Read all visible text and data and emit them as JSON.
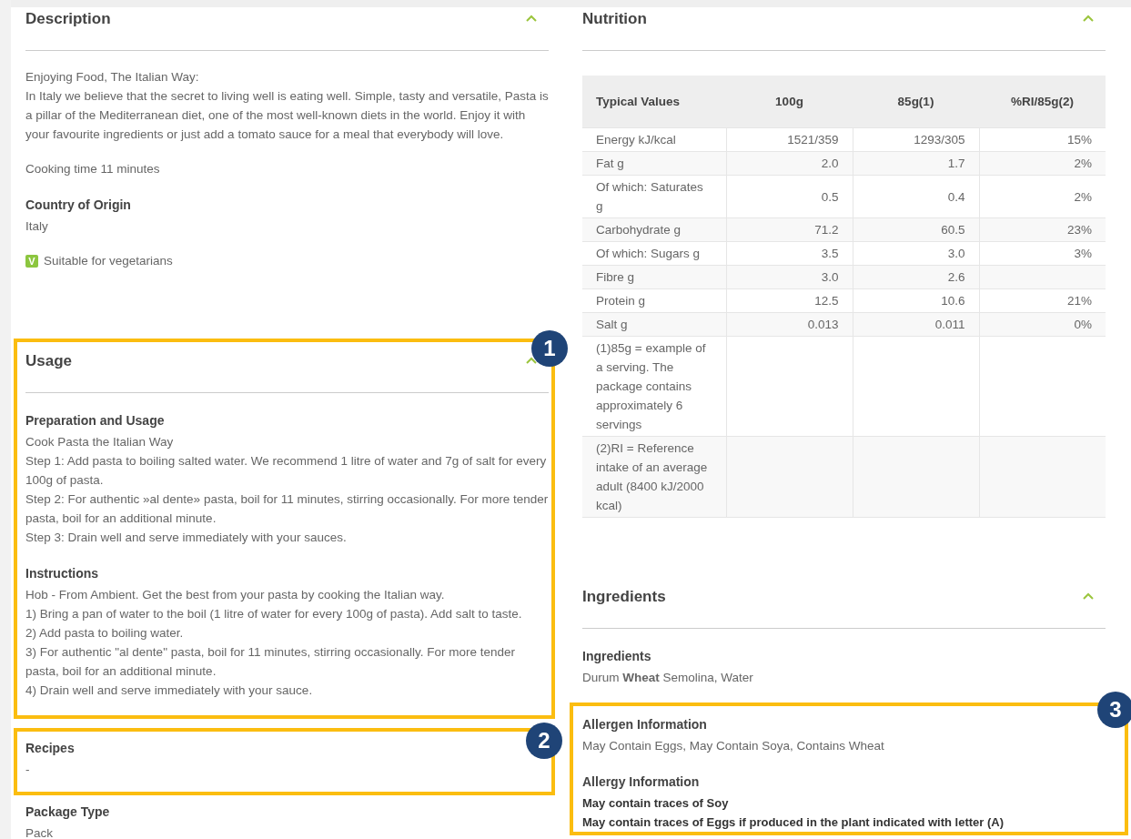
{
  "columns": [
    {
      "items": [
        {
          "kind": "panel",
          "title": "Description",
          "expanded": true,
          "blocks": [
            {
              "kind": "paragraph",
              "lines": [
                "Enjoying Food, The Italian Way:",
                "In Italy we believe that the secret to living well is eating well. Simple, tasty and versatile, Pasta is a pillar of the Mediterranean diet, one of the most well-known diets in the world. Enjoy it with your favourite ingredients or just add a tomato sauce for a meal that everybody will love."
              ]
            },
            {
              "kind": "paragraph",
              "lines": [
                "Cooking time 11 minutes"
              ]
            },
            {
              "kind": "field",
              "label": "Country of Origin",
              "lines": [
                {
                  "text": "Italy",
                  "emphasis": false
                }
              ]
            },
            {
              "kind": "badge",
              "mark": "V",
              "label": "Suitable for vegetarians"
            }
          ]
        },
        {
          "kind": "panel",
          "title": "Usage",
          "expanded": true,
          "callout": "1",
          "blocks": [
            {
              "kind": "field",
              "label": "Preparation and Usage",
              "lines": [
                {
                  "text": "Cook Pasta the Italian Way",
                  "emphasis": false
                },
                {
                  "text": "Step 1: Add pasta to boiling salted water. We recommend 1 litre of water and 7g of salt for every 100g of pasta.",
                  "emphasis": false
                },
                {
                  "text": "Step 2: For authentic »al dente» pasta, boil for 11 minutes, stirring occasionally. For more tender pasta, boil for an additional minute.",
                  "emphasis": false
                },
                {
                  "text": "Step 3: Drain well and serve immediately with your sauces.",
                  "emphasis": false
                }
              ]
            },
            {
              "kind": "field",
              "label": "Instructions",
              "lines": [
                {
                  "text": "Hob - From Ambient. Get the best from your pasta by cooking the Italian way.",
                  "emphasis": false
                },
                {
                  "text": "1) Bring a pan of water to the boil (1 litre of water for every 100g of pasta). Add salt to taste.",
                  "emphasis": false
                },
                {
                  "text": "2) Add pasta to boiling water.",
                  "emphasis": false
                },
                {
                  "text": "3) For authentic \"al dente\" pasta, boil for 11 minutes, stirring occasionally. For more tender pasta, boil for an additional minute.",
                  "emphasis": false
                },
                {
                  "text": "4) Drain well and serve immediately with your sauce.",
                  "emphasis": false
                }
              ]
            }
          ]
        },
        {
          "kind": "field",
          "label": "Recipes",
          "callout": "2",
          "lines": [
            {
              "text": "-",
              "emphasis": false
            }
          ]
        },
        {
          "kind": "field",
          "label": "Package Type",
          "lines": [
            {
              "text": "Pack",
              "emphasis": false
            }
          ]
        }
      ]
    },
    {
      "items": [
        {
          "kind": "panel",
          "title": "Nutrition",
          "expanded": true,
          "blocks": [
            {
              "kind": "table",
              "columns": [
                "Typical Values",
                "100g",
                "85g(1)",
                "%RI/85g(2)"
              ],
              "rows": [
                [
                  "Energy kJ/kcal",
                  "1521/359",
                  "1293/305",
                  "15%"
                ],
                [
                  "Fat g",
                  "2.0",
                  "1.7",
                  "2%"
                ],
                [
                  "Of which: Saturates g",
                  "0.5",
                  "0.4",
                  "2%"
                ],
                [
                  "Carbohydrate g",
                  "71.2",
                  "60.5",
                  "23%"
                ],
                [
                  "Of which: Sugars g",
                  "3.5",
                  "3.0",
                  "3%"
                ],
                [
                  "Fibre g",
                  "3.0",
                  "2.6"
                ],
                [
                  "Protein g",
                  "12.5",
                  "10.6",
                  "21%"
                ],
                [
                  "Salt g",
                  "0.013",
                  "0.011",
                  "0%"
                ],
                [
                  "(1)85g = example of a serving. The package contains approximately 6 servings"
                ],
                [
                  "(2)RI = Reference intake of an average adult (8400 kJ/2000 kcal)"
                ]
              ]
            }
          ]
        },
        {
          "kind": "panel",
          "title": "Ingredients",
          "expanded": true,
          "blocks": [
            {
              "kind": "field",
              "label": "Ingredients",
              "lines": [
                {
                  "text": "Durum **Wheat** Semolina, Water",
                  "emphasis": false
                }
              ]
            },
            {
              "kind": "group",
              "callout": "3",
              "blocks": [
                {
                  "kind": "field",
                  "label": "Allergen Information",
                  "lines": [
                    {
                      "text": "May Contain Eggs, May Contain Soya, Contains Wheat",
                      "emphasis": false
                    }
                  ]
                },
                {
                  "kind": "field",
                  "label": "Allergy Information",
                  "lines": [
                    {
                      "text": "May contain traces of Soy",
                      "emphasis": true
                    },
                    {
                      "text": "May contain traces of Eggs if produced in the plant indicated with letter (A)",
                      "emphasis": true
                    }
                  ]
                }
              ]
            }
          ]
        }
      ]
    }
  ]
}
